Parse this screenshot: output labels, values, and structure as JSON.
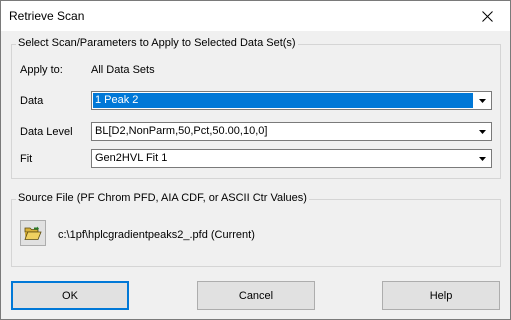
{
  "window": {
    "title": "Retrieve Scan"
  },
  "params_group": {
    "legend": "Select Scan/Parameters to Apply to Selected Data Set(s)",
    "apply_to_label": "Apply to:",
    "apply_to_value": "All Data Sets",
    "data_label": "Data",
    "data_value": "1 Peak 2",
    "data_level_label": "Data Level",
    "data_level_value": "BL[D2,NonParm,50,Pct,50.00,10,0]",
    "fit_label": "Fit",
    "fit_value": "Gen2HVL Fit 1"
  },
  "source_group": {
    "legend": "Source File (PF Chrom PFD, AIA CDF, or ASCII Ctr Values)",
    "file_path": "c:\\1pf\\hplcgradientpeaks2_.pfd (Current)"
  },
  "buttons": {
    "ok": "OK",
    "cancel": "Cancel",
    "help": "Help"
  },
  "colors": {
    "selection": "#0078d7",
    "dialog_bg": "#f0f0f0",
    "folder_yellow": "#e8c24a"
  },
  "icons": {
    "close": "close-icon",
    "folder": "open-folder-icon",
    "dropdown": "chevron-down-icon"
  }
}
